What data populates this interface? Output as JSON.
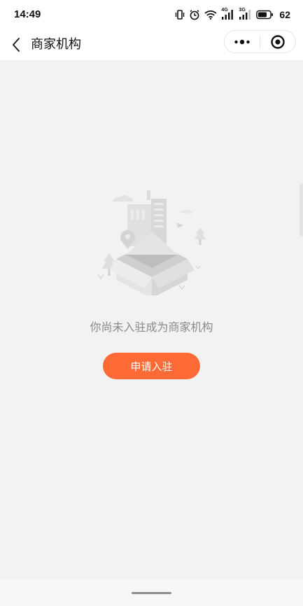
{
  "status_bar": {
    "time": "14:49",
    "battery": "62",
    "icons": [
      "vibrate-icon",
      "alarm-icon",
      "wifi-icon",
      "signal-4g-icon",
      "signal-3g-icon",
      "battery-icon"
    ],
    "signal_labels": [
      "4G",
      "3G"
    ]
  },
  "nav": {
    "title": "商家机构",
    "back_icon": "chevron-left-icon",
    "more_icon": "more-dots-icon",
    "close_icon": "target-circle-icon"
  },
  "empty_state": {
    "illustration": "empty-box-illustration",
    "message": "你尚未入驻成为商家机构",
    "button_label": "申请入驻"
  },
  "colors": {
    "accent": "#fe6a35",
    "background": "#f2f2f2",
    "text_muted": "#8a8a8a"
  }
}
